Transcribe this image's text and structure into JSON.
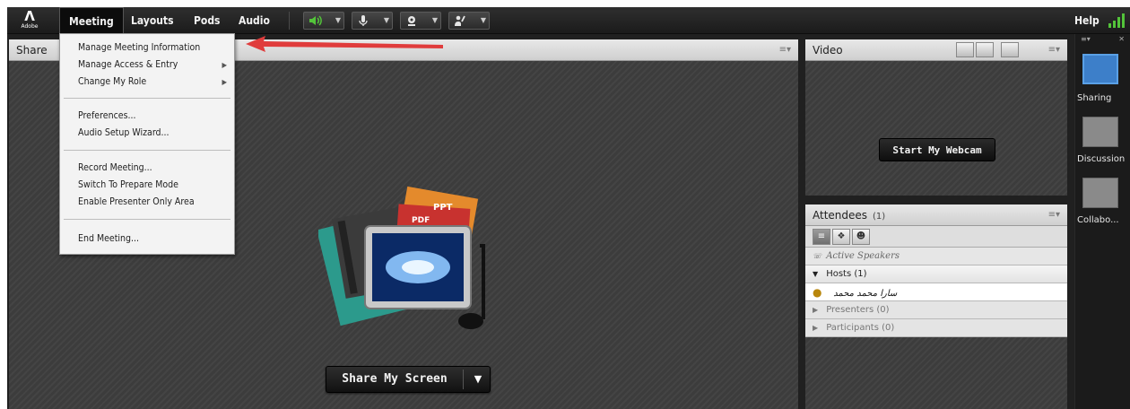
{
  "menubar": {
    "logo_text": "Adobe",
    "menus": [
      "Meeting",
      "Layouts",
      "Pods",
      "Audio"
    ],
    "help_label": "Help",
    "toolbar_icons": [
      "speaker-icon",
      "microphone-icon",
      "webcam-icon",
      "raise-hand-icon"
    ]
  },
  "meeting_menu": {
    "groups": [
      [
        {
          "label": "Manage Meeting Information",
          "submenu": false
        },
        {
          "label": "Manage Access & Entry",
          "submenu": true
        },
        {
          "label": "Change My Role",
          "submenu": true
        }
      ],
      [
        {
          "label": "Preferences...",
          "submenu": false
        },
        {
          "label": "Audio Setup Wizard...",
          "submenu": false
        }
      ],
      [
        {
          "label": "Record Meeting...",
          "submenu": false
        },
        {
          "label": "Switch To Prepare Mode",
          "submenu": false
        },
        {
          "label": "Enable Presenter Only Area",
          "submenu": false
        }
      ],
      [
        {
          "label": "End Meeting...",
          "submenu": false
        }
      ]
    ]
  },
  "share_pod": {
    "title": "Share",
    "share_button": "Share My Screen",
    "graphic_labels": [
      "PPT",
      "PDF"
    ]
  },
  "video_pod": {
    "title": "Video",
    "start_button": "Start My Webcam"
  },
  "attendees_pod": {
    "title": "Attendees",
    "count": "(1)",
    "active_speakers": "Active Speakers",
    "hosts": "Hosts (1)",
    "host_user": "ﺳﺎﺭﺍ ﻣﺤﻤﺪ ﻣﺤﻤﺪ",
    "presenters": "Presenters (0)",
    "participants": "Participants (0)"
  },
  "layouts": [
    {
      "label": "Sharing",
      "selected": true
    },
    {
      "label": "Discussion",
      "selected": false
    },
    {
      "label": "Collabo...",
      "selected": false
    }
  ],
  "colors": {
    "accent_arrow": "#e03c3c",
    "selected_layout": "#3d7fc9",
    "audio_green": "#53c43a"
  }
}
